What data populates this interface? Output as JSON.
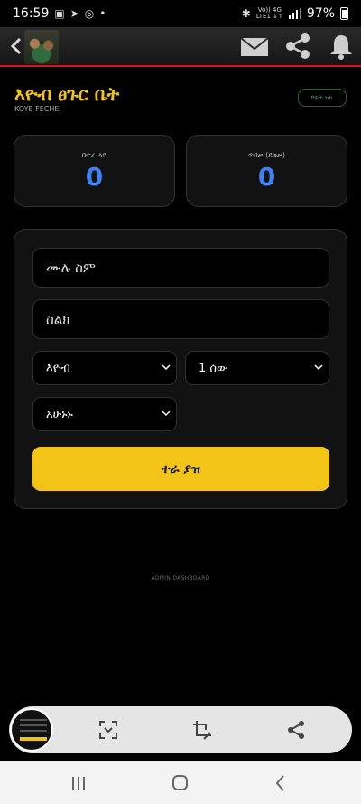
{
  "status_bar": {
    "time": "16:59",
    "battery": "97%",
    "network_top": "Vo)) 4G",
    "network_bottom": "LTE1 ↓↑"
  },
  "shop": {
    "title": "እዮብ ፀጉር ቤት",
    "subtitle": "KOYE FECHE",
    "status_badge": "ክፍት ነው"
  },
  "stats": [
    {
      "label": "በተራ ላይ",
      "value": "0"
    },
    {
      "label": "ጥበቃ (ደቂቃ)",
      "value": "0"
    }
  ],
  "form": {
    "name_placeholder": "ሙሉ ስም",
    "phone_placeholder": "ስልክ",
    "barber_select": "እዮብ",
    "people_select": "1 ሰው",
    "time_select": "አሁኑኑ",
    "submit_label": "ተራ ያዝ"
  },
  "footer": {
    "admin_link": "ADMIN DASHBOARD"
  },
  "icons": {
    "header": [
      "back-icon",
      "mail-icon",
      "share-icon",
      "bell-icon"
    ],
    "capture_bar": [
      "scan-icon",
      "crop-edit-icon",
      "share-icon"
    ],
    "nav": [
      "recents-icon",
      "home-icon",
      "back-icon"
    ]
  },
  "colors": {
    "accent": "#f2c418",
    "stat_value": "#3b82f6",
    "header_border": "#d11111",
    "badge": "#3fa055"
  }
}
